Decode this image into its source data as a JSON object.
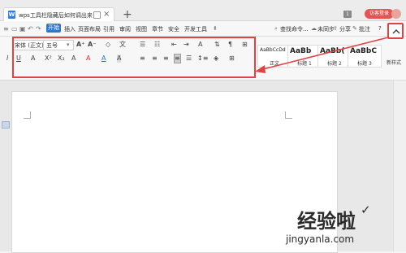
{
  "titlebar": {
    "tab_title": "wps工具栏隐藏后如何调出来",
    "new_tab": "+",
    "page_count": "1",
    "visitor_label": "访客登录"
  },
  "menu": {
    "items": [
      "开始",
      "插入",
      "页面布局",
      "引用",
      "审阅",
      "视图",
      "章节",
      "安全",
      "开发工具"
    ],
    "right": {
      "search": "查找命令...",
      "sync": "未同步",
      "share": "分享",
      "review": "批注",
      "help": "?"
    }
  },
  "ribbon": {
    "font_name": "宋体 (正文)",
    "font_size": "五号",
    "row2_text_buttons": [
      "I",
      "U",
      "A",
      "X²",
      "X₂",
      "A",
      "A",
      "A",
      "A"
    ],
    "style_gallery": [
      {
        "preview": "AaBbCcDd",
        "name": "正文"
      },
      {
        "preview": "AaBb",
        "name": "标题 1"
      },
      {
        "preview": "AaBb(",
        "name": "标题 2"
      },
      {
        "preview": "AaBbC",
        "name": "标题 3"
      }
    ],
    "style_more": "新样式"
  },
  "colors": {
    "accent_blue": "#2e77d0",
    "highlight_red": "#e04343",
    "visitor_red": "#e45454"
  },
  "watermark": {
    "line1": "经验啦",
    "line2": "jingyanla.com"
  }
}
